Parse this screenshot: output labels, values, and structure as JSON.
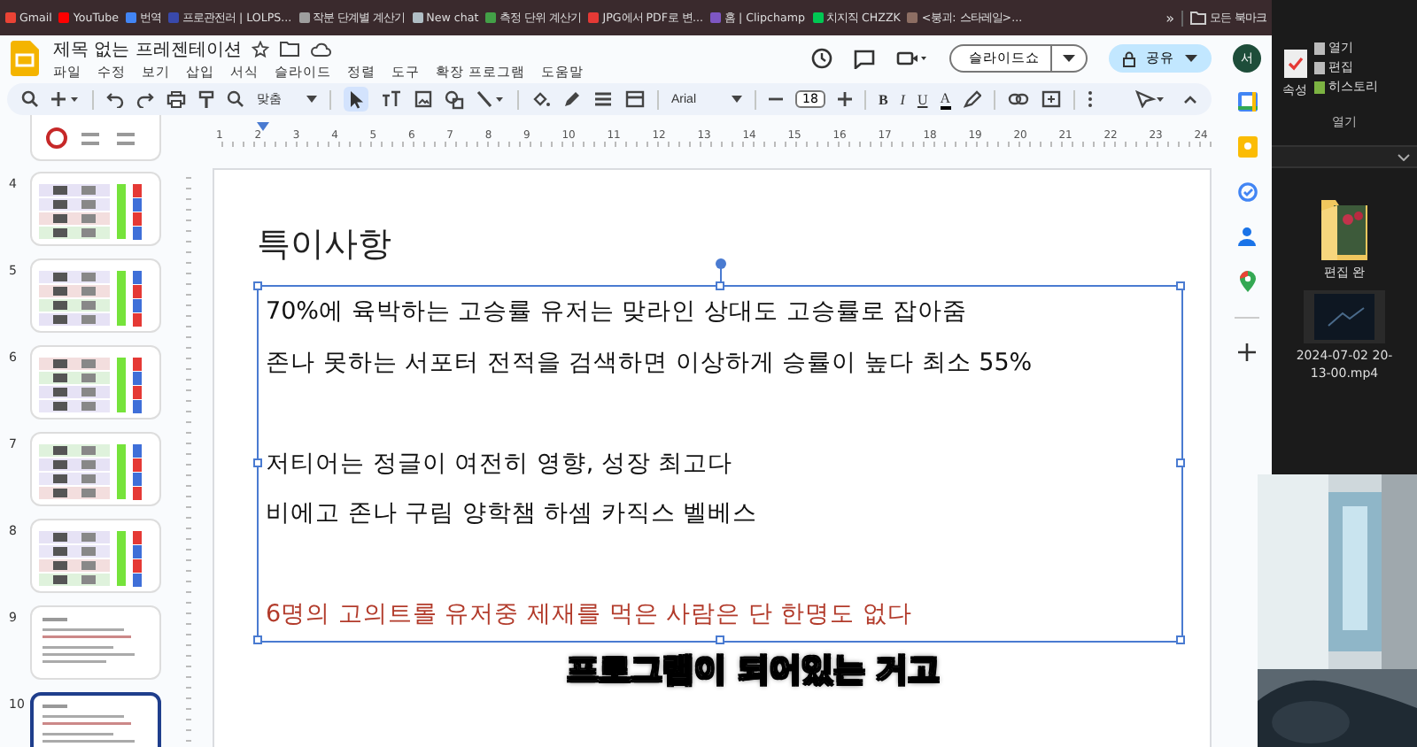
{
  "bookmarks": [
    "Gmail",
    "YouTube",
    "번역",
    "프로관전러 | LOLPS...",
    "작분 단계별 계산기",
    "New chat",
    "측정 단위 계산기",
    "JPG에서 PDF로 변...",
    "홈 | Clipchamp",
    "치지직 CHZZK",
    "<붕괴: 스타레일>..."
  ],
  "bookmarks_more": "»",
  "all_bookmarks": "모든 북마크",
  "title": "제목 없는 프레젠테이션",
  "menus": [
    "파일",
    "수정",
    "보기",
    "삽입",
    "서식",
    "슬라이드",
    "정렬",
    "도구",
    "확장 프로그램",
    "도움말"
  ],
  "slideshow_button": "슬라이드쇼",
  "share_button": "공유",
  "avatar": "서",
  "toolbar": {
    "zoom": "맞춤",
    "font": "Arial",
    "font_size": "18",
    "format": [
      "B",
      "I",
      "U",
      "A"
    ]
  },
  "ruler_numbers": [
    "1",
    "2",
    "3",
    "4",
    "5",
    "6",
    "7",
    "8",
    "9",
    "10",
    "11",
    "12",
    "13",
    "14",
    "15",
    "16",
    "17",
    "18",
    "19",
    "20",
    "21",
    "22",
    "23",
    "24"
  ],
  "thumbnails": [
    {
      "kind": "chart",
      "selected": false
    },
    {
      "number": "4",
      "kind": "table",
      "selected": false
    },
    {
      "number": "5",
      "kind": "table",
      "selected": false
    },
    {
      "number": "6",
      "kind": "table",
      "selected": false
    },
    {
      "number": "7",
      "kind": "table",
      "selected": false
    },
    {
      "number": "8",
      "kind": "table",
      "selected": false
    },
    {
      "number": "9",
      "kind": "text",
      "selected": false
    },
    {
      "number": "10",
      "kind": "text",
      "selected": true
    }
  ],
  "slide": {
    "title": "특이사항",
    "lines": [
      {
        "kind": "normal",
        "text": "70%에 육박하는 고승률 유저는 맞라인 상대도 고승률로 잡아줌"
      },
      {
        "kind": "normal",
        "text": "존나 못하는 서포터 전적을 검색하면 이상하게 승률이 높다 최소 55%"
      },
      {
        "kind": "blank"
      },
      {
        "kind": "normal",
        "text": "저티어는 정글이 여전히 영향, 성장 최고다"
      },
      {
        "kind": "normal",
        "text": "비에고 존나 구림 양학챔 하셈 카직스 벨베스"
      },
      {
        "kind": "blank"
      },
      {
        "kind": "warning",
        "text": "6명의 고의트롤 유저중 제재를 먹은 사람은 단 한명도 없다"
      }
    ]
  },
  "subtitle": "프로그램이 되어있는 거고",
  "explorer": {
    "properties_button": "속성",
    "open_button": "열기",
    "edit_button": "편집",
    "history_button": "히스토리",
    "group_label": "열기",
    "files": [
      {
        "kind": "folder",
        "name": "편집 완"
      },
      {
        "kind": "video",
        "name": "2024-07-02 20-13-00.mp4"
      }
    ]
  },
  "webcam": {
    "kind": "picture"
  }
}
